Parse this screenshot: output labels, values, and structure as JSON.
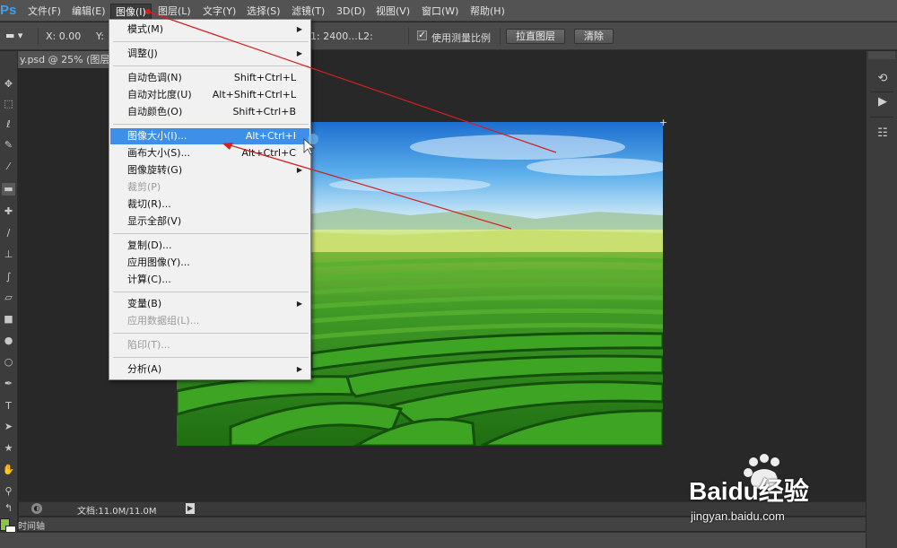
{
  "app": {
    "logo_text": "Ps",
    "menu": [
      "文件(F)",
      "编辑(E)",
      "图像(I)",
      "图层(L)",
      "文字(Y)",
      "选择(S)",
      "滤镜(T)",
      "3D(D)",
      "视图(V)",
      "窗口(W)",
      "帮助(H)"
    ],
    "active_menu_index": 2
  },
  "options_bar": {
    "x_label": "X: 0.00",
    "y_label": "Y:",
    "l1_text": "1: 2400...",
    "l2_label": "L2:",
    "use_scale_label": "使用测量比例",
    "use_scale_checked": true,
    "straighten_button": "拉直图层",
    "clear_button": "清除"
  },
  "document": {
    "tab_title": "y.psd @ 25% (图层 6",
    "status_text": "文档:11.0M/11.0M",
    "timeline_label": "时间轴"
  },
  "image_menu": {
    "items": [
      {
        "label": "模式(M)",
        "shortcut": "",
        "submenu": true,
        "disabled": false,
        "highlighted": false
      },
      {
        "sep": true
      },
      {
        "label": "调整(J)",
        "shortcut": "",
        "submenu": true,
        "disabled": false,
        "highlighted": false
      },
      {
        "sep": true
      },
      {
        "label": "自动色调(N)",
        "shortcut": "Shift+Ctrl+L",
        "submenu": false,
        "disabled": false,
        "highlighted": false
      },
      {
        "label": "自动对比度(U)",
        "shortcut": "Alt+Shift+Ctrl+L",
        "submenu": false,
        "disabled": false,
        "highlighted": false
      },
      {
        "label": "自动颜色(O)",
        "shortcut": "Shift+Ctrl+B",
        "submenu": false,
        "disabled": false,
        "highlighted": false
      },
      {
        "sep": true
      },
      {
        "label": "图像大小(I)...",
        "shortcut": "Alt+Ctrl+I",
        "submenu": false,
        "disabled": false,
        "highlighted": true
      },
      {
        "label": "画布大小(S)...",
        "shortcut": "Alt+Ctrl+C",
        "submenu": false,
        "disabled": false,
        "highlighted": false
      },
      {
        "label": "图像旋转(G)",
        "shortcut": "",
        "submenu": true,
        "disabled": false,
        "highlighted": false
      },
      {
        "label": "裁剪(P)",
        "shortcut": "",
        "submenu": false,
        "disabled": true,
        "highlighted": false
      },
      {
        "label": "裁切(R)...",
        "shortcut": "",
        "submenu": false,
        "disabled": false,
        "highlighted": false
      },
      {
        "label": "显示全部(V)",
        "shortcut": "",
        "submenu": false,
        "disabled": false,
        "highlighted": false
      },
      {
        "sep": true
      },
      {
        "label": "复制(D)...",
        "shortcut": "",
        "submenu": false,
        "disabled": false,
        "highlighted": false
      },
      {
        "label": "应用图像(Y)...",
        "shortcut": "",
        "submenu": false,
        "disabled": false,
        "highlighted": false
      },
      {
        "label": "计算(C)...",
        "shortcut": "",
        "submenu": false,
        "disabled": false,
        "highlighted": false
      },
      {
        "sep": true
      },
      {
        "label": "变量(B)",
        "shortcut": "",
        "submenu": true,
        "disabled": false,
        "highlighted": false
      },
      {
        "label": "应用数据组(L)...",
        "shortcut": "",
        "submenu": false,
        "disabled": true,
        "highlighted": false
      },
      {
        "sep": true
      },
      {
        "label": "陷印(T)...",
        "shortcut": "",
        "submenu": false,
        "disabled": true,
        "highlighted": false
      },
      {
        "sep": true
      },
      {
        "label": "分析(A)",
        "shortcut": "",
        "submenu": true,
        "disabled": false,
        "highlighted": false
      }
    ]
  },
  "watermark": {
    "brand": "Baidu经验",
    "url": "jingyan.baidu.com"
  },
  "colors": {
    "accent_highlight": "#3e8fe8",
    "foreground_swatch": "#8bc43f",
    "background_swatch": "#ffffff",
    "annotation_arrow": "#d42020"
  }
}
